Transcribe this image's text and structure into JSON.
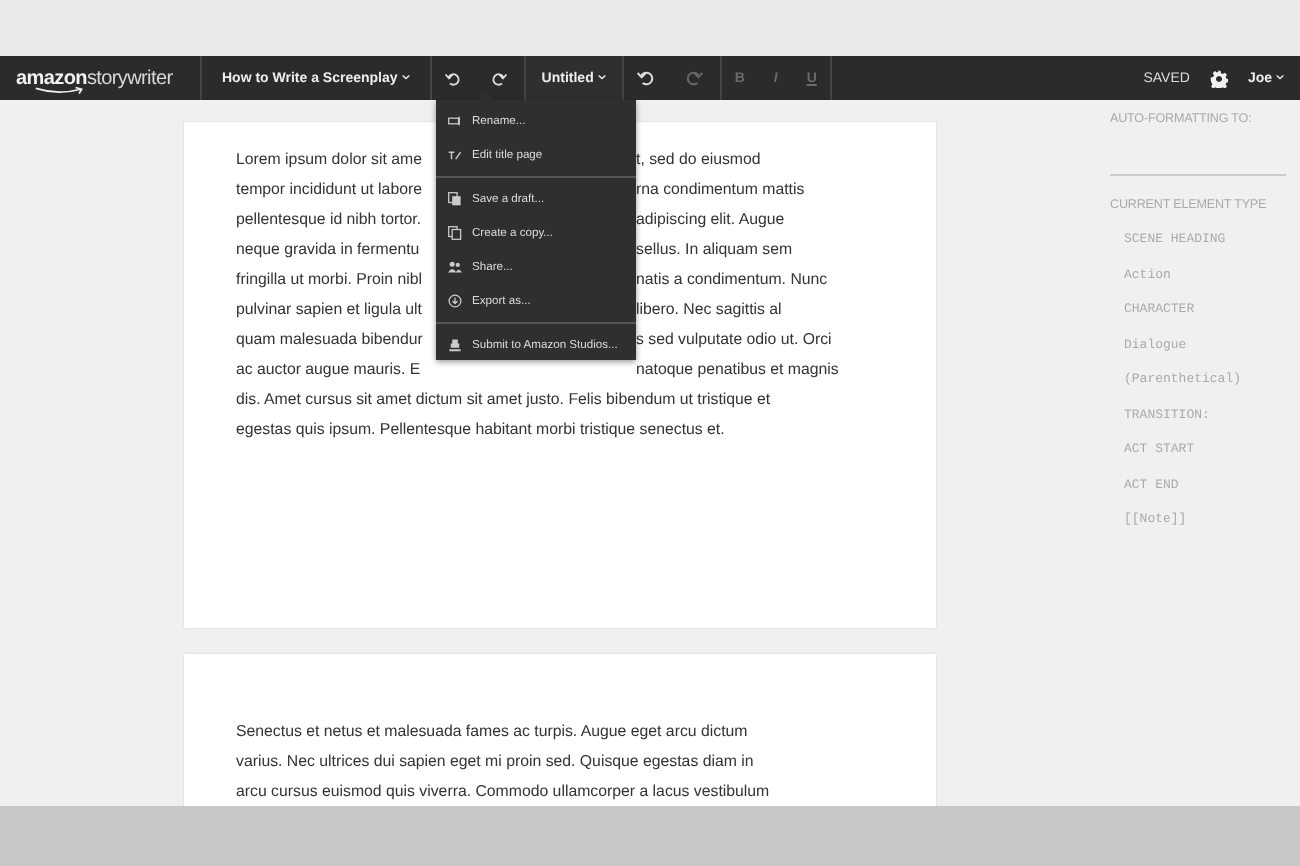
{
  "logo": {
    "brand": "amazon",
    "product": "storywriter"
  },
  "project": {
    "label": "How to Write a Screenplay"
  },
  "history_left": [
    {
      "kind": "undo",
      "disabled": false
    },
    {
      "kind": "redo",
      "disabled": false
    }
  ],
  "document": {
    "label": "Untitled",
    "expanded": true
  },
  "history_right": [
    {
      "kind": "undo",
      "disabled": false
    },
    {
      "kind": "redo",
      "disabled": true
    }
  ],
  "format_buttons": [
    {
      "label": "B",
      "disabled": true
    },
    {
      "label": "I",
      "disabled": true
    },
    {
      "label": "U",
      "disabled": true
    }
  ],
  "status": "SAVED",
  "user": {
    "label": "Joe"
  },
  "menu": {
    "groups": [
      [
        {
          "kind": "rename",
          "label": "Rename..."
        },
        {
          "kind": "title",
          "label": "Edit title page"
        }
      ],
      [
        {
          "kind": "draft",
          "label": "Save a draft..."
        },
        {
          "kind": "copy",
          "label": "Create a copy..."
        },
        {
          "kind": "share",
          "label": "Share..."
        },
        {
          "kind": "export",
          "label": "Export as..."
        }
      ],
      [
        {
          "kind": "submit",
          "label": "Submit to Amazon Studios..."
        }
      ]
    ]
  },
  "pages": [
    {
      "lines": [
        {
          "left": "Lorem ipsum dolor sit ame",
          "right": "t, sed do eiusmod"
        },
        {
          "left": "tempor incididunt ut labore",
          "right": "rna condimentum mattis"
        },
        {
          "left": "pellentesque id nibh tortor.",
          "right": "adipiscing elit. Augue"
        },
        {
          "left": "neque gravida in fermentu",
          "right": "sellus. In aliquam sem"
        },
        {
          "left": "fringilla ut morbi. Proin nibl",
          "right": "natis a condimentum. Nunc"
        },
        {
          "left": "pulvinar sapien et ligula ult",
          "right": "libero. Nec sagittis al"
        },
        {
          "left": "quam malesuada bibendur",
          "right": "s sed vulputate odio ut. Orci"
        },
        {
          "left": "ac auctor augue mauris. E",
          "right": "natoque penatibus et magnis"
        },
        {
          "full": "dis. Amet cursus sit amet dictum sit amet justo. Felis bibendum ut tristique et"
        },
        {
          "full": "egestas quis ipsum. Pellentesque habitant morbi tristique senectus et."
        }
      ]
    },
    {
      "lines": [
        {
          "full": "Senectus et netus et malesuada fames ac turpis. Augue eget arcu dictum"
        },
        {
          "full": "varius. Nec ultrices dui sapien eget mi proin sed. Quisque egestas diam in"
        },
        {
          "full": "arcu cursus euismod quis viverra. Commodo ullamcorper a lacus vestibulum"
        }
      ]
    }
  ],
  "sidebar": {
    "auto_formatting_label": "AUTO-FORMATTING TO:",
    "element_type_label": "CURRENT ELEMENT TYPE",
    "element_types": [
      "SCENE HEADING",
      "Action",
      "CHARACTER",
      "Dialogue",
      "(Parenthetical)",
      "TRANSITION:",
      "ACT START",
      "ACT END",
      "[[Note]]"
    ]
  }
}
